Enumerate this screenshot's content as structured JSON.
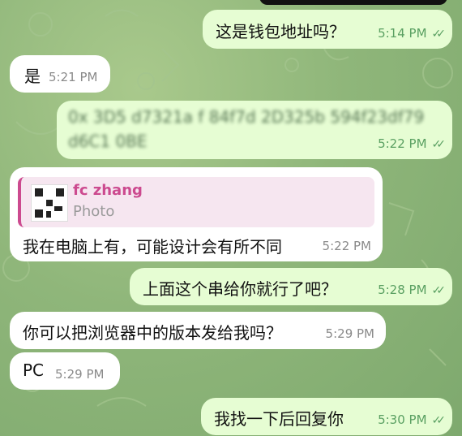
{
  "messages": [
    {
      "text": "这是钱包地址吗？",
      "time": "5:14 PM"
    },
    {
      "text": "是",
      "time": "5:21 PM"
    },
    {
      "line1": "0x 3D5 d7321a f 84f7d  2D325b 594f23df79",
      "line2": "d6C1 0BE",
      "time": "5:22 PM"
    },
    {
      "reply_name": "fc zhang",
      "reply_sub": "Photo",
      "text": "我在电脑上有，可能设计会有所不同",
      "time": "5:22 PM"
    },
    {
      "text": "上面这个串给你就行了吧？",
      "time": "5:28 PM"
    },
    {
      "text": "你可以把浏览器中的版本发给我吗？",
      "time": "5:29 PM"
    },
    {
      "text": "PC",
      "time": "5:29 PM"
    },
    {
      "text": "我找一下后回复你",
      "time": "5:30 PM"
    }
  ],
  "colors": {
    "outgoing": "#e6fdd3",
    "incoming": "#ffffff",
    "accent": "#cc4a8f",
    "check": "#5aa062"
  },
  "icons": {
    "read_receipt": "double-check-icon",
    "photo": "qr-code-thumbnail"
  }
}
